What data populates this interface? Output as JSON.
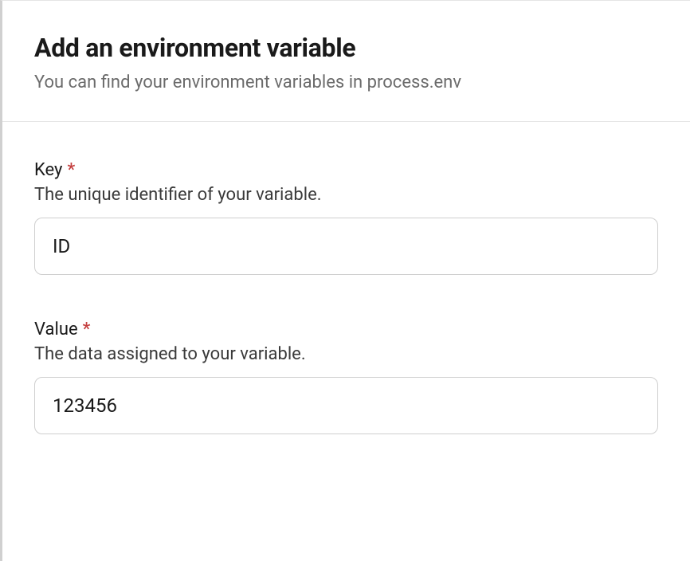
{
  "header": {
    "title": "Add an environment variable",
    "subtitle": "You can find your environment variables in process.env"
  },
  "fields": {
    "key": {
      "label": "Key",
      "required_marker": "*",
      "description": "The unique identifier of your variable.",
      "value": "ID"
    },
    "value": {
      "label": "Value",
      "required_marker": "*",
      "description": "The data assigned to your variable.",
      "value": "123456"
    }
  }
}
